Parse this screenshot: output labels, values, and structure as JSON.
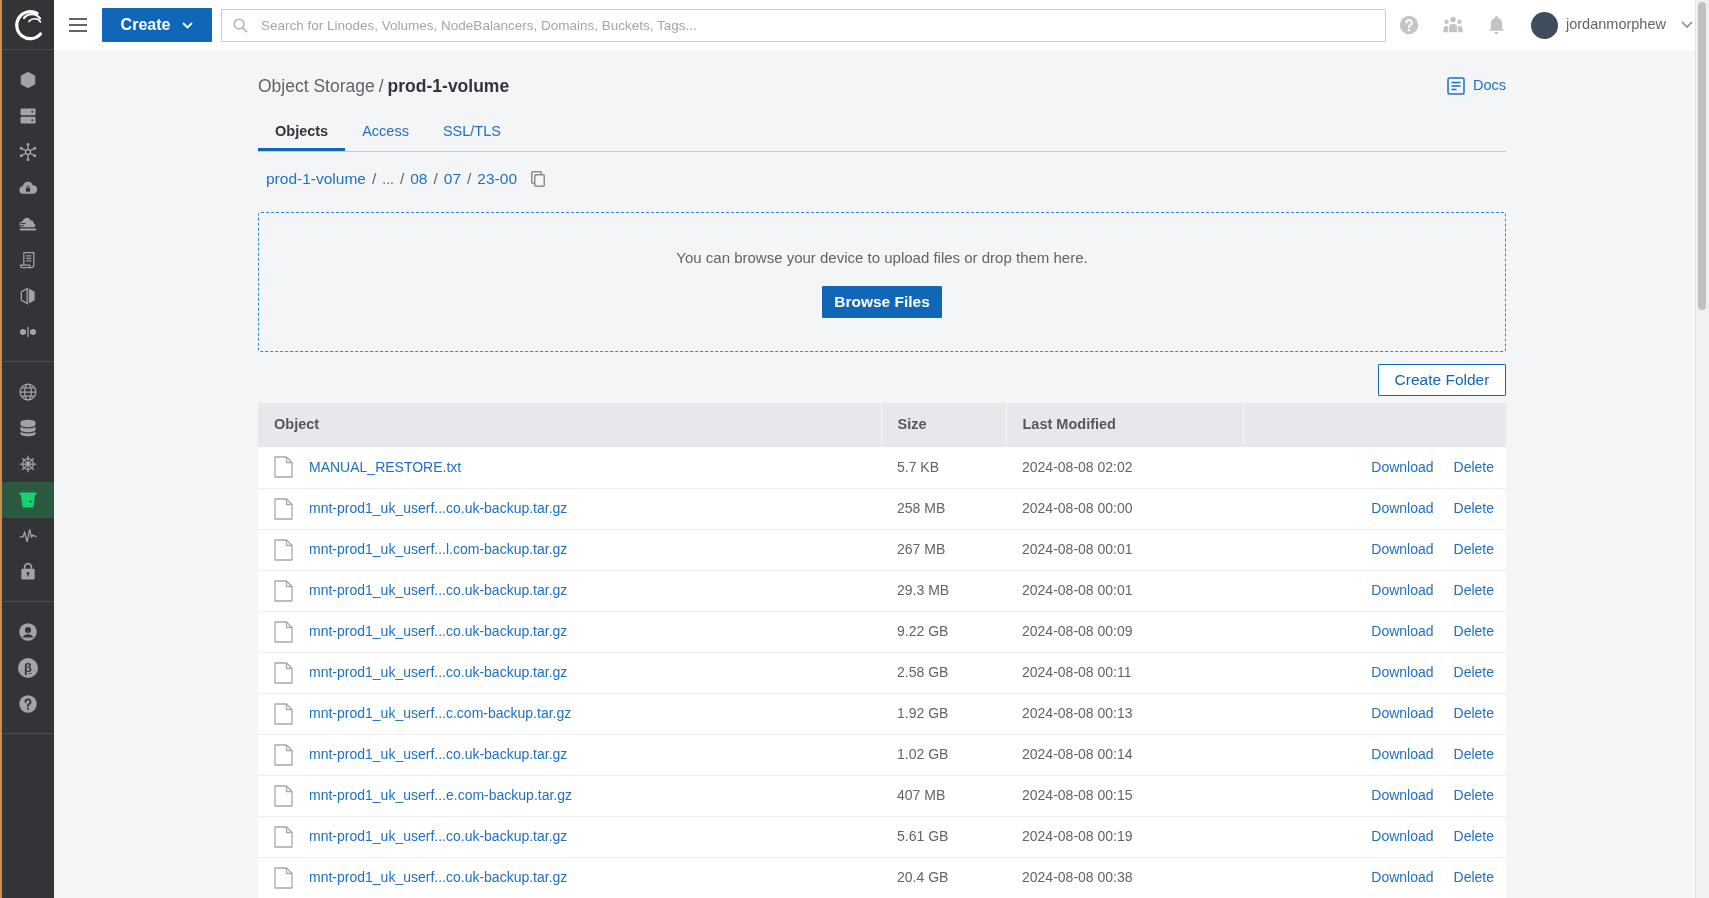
{
  "sidebar": {
    "groups": [
      {
        "items": [
          {
            "selected": false
          },
          {
            "selected": false
          },
          {
            "selected": false
          },
          {
            "selected": false
          },
          {
            "selected": false
          },
          {
            "selected": false
          },
          {
            "selected": false
          },
          {
            "selected": false
          }
        ]
      },
      {
        "items": [
          {
            "selected": false
          },
          {
            "selected": false
          },
          {
            "selected": false
          },
          {
            "selected": true
          },
          {
            "selected": false
          },
          {
            "selected": false
          }
        ]
      },
      {
        "items": [
          {
            "selected": false
          },
          {
            "selected": false,
            "symbol": "β"
          },
          {
            "selected": false
          }
        ]
      }
    ]
  },
  "topbar": {
    "create_button": "Create",
    "search": {
      "placeholder": "Search for Linodes, Volumes, NodeBalancers, Domains, Buckets, Tags..."
    },
    "user": {
      "name": "jordanmorphew"
    }
  },
  "header": {
    "breadcrumb": {
      "parent": "Object Storage",
      "separator": "/",
      "current": "prod-1-volume"
    },
    "docs_link": "Docs"
  },
  "tabs": [
    {
      "label": "Objects",
      "selected": true
    },
    {
      "label": "Access",
      "selected": false
    },
    {
      "label": "SSL/TLS",
      "selected": false
    }
  ],
  "path": [
    {
      "kind": "link",
      "text": "prod-1-volume"
    },
    {
      "kind": "separator",
      "text": "/"
    },
    {
      "kind": "ellipsis",
      "text": "..."
    },
    {
      "kind": "separator",
      "text": "/"
    },
    {
      "kind": "link",
      "text": "08"
    },
    {
      "kind": "separator",
      "text": "/"
    },
    {
      "kind": "link",
      "text": "07"
    },
    {
      "kind": "separator",
      "text": "/"
    },
    {
      "kind": "link",
      "text": "23-00"
    }
  ],
  "upload": {
    "message": "You can browse your device to upload files or drop them here.",
    "button": "Browse Files"
  },
  "create_folder_button": "Create Folder",
  "table": {
    "columns": [
      "Object",
      "Size",
      "Last Modified"
    ],
    "rows": [
      {
        "name": "MANUAL_RESTORE.txt",
        "size": "5.7 KB",
        "modified": "2024-08-08 02:02",
        "actions": [
          "Download",
          "Delete"
        ]
      },
      {
        "name": "mnt-prod1_uk_userf...co.uk-backup.tar.gz",
        "size": "258 MB",
        "modified": "2024-08-08 00:00",
        "actions": [
          "Download",
          "Delete"
        ]
      },
      {
        "name": "mnt-prod1_uk_userf...l.com-backup.tar.gz",
        "size": "267 MB",
        "modified": "2024-08-08 00:01",
        "actions": [
          "Download",
          "Delete"
        ]
      },
      {
        "name": "mnt-prod1_uk_userf...co.uk-backup.tar.gz",
        "size": "29.3 MB",
        "modified": "2024-08-08 00:01",
        "actions": [
          "Download",
          "Delete"
        ]
      },
      {
        "name": "mnt-prod1_uk_userf...co.uk-backup.tar.gz",
        "size": "9.22 GB",
        "modified": "2024-08-08 00:09",
        "actions": [
          "Download",
          "Delete"
        ]
      },
      {
        "name": "mnt-prod1_uk_userf...co.uk-backup.tar.gz",
        "size": "2.58 GB",
        "modified": "2024-08-08 00:11",
        "actions": [
          "Download",
          "Delete"
        ]
      },
      {
        "name": "mnt-prod1_uk_userf...c.com-backup.tar.gz",
        "size": "1.92 GB",
        "modified": "2024-08-08 00:13",
        "actions": [
          "Download",
          "Delete"
        ]
      },
      {
        "name": "mnt-prod1_uk_userf...co.uk-backup.tar.gz",
        "size": "1.02 GB",
        "modified": "2024-08-08 00:14",
        "actions": [
          "Download",
          "Delete"
        ]
      },
      {
        "name": "mnt-prod1_uk_userf...e.com-backup.tar.gz",
        "size": "407 MB",
        "modified": "2024-08-08 00:15",
        "actions": [
          "Download",
          "Delete"
        ]
      },
      {
        "name": "mnt-prod1_uk_userf...co.uk-backup.tar.gz",
        "size": "5.61 GB",
        "modified": "2024-08-08 00:19",
        "actions": [
          "Download",
          "Delete"
        ]
      },
      {
        "name": "mnt-prod1_uk_userf...co.uk-backup.tar.gz",
        "size": "20.4 GB",
        "modified": "2024-08-08 00:38",
        "actions": [
          "Download",
          "Delete"
        ]
      }
    ]
  }
}
